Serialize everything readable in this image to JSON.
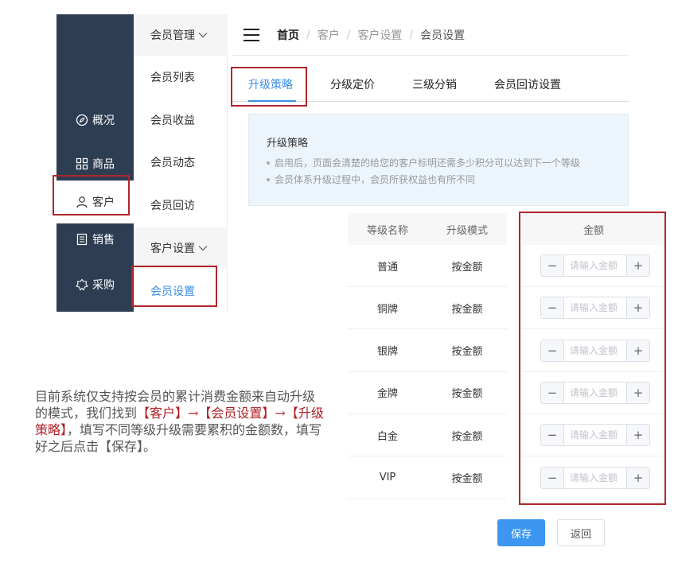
{
  "dark_sidebar": {
    "items": [
      {
        "label": "概况",
        "icon": "compass-icon"
      },
      {
        "label": "商品",
        "icon": "grid-icon"
      },
      {
        "label": "客户",
        "icon": "user-icon"
      },
      {
        "label": "销售",
        "icon": "document-icon"
      },
      {
        "label": "采购",
        "icon": "badge-icon"
      }
    ]
  },
  "sub_menu": {
    "group1": "会员管理",
    "items1": [
      "会员列表",
      "会员收益",
      "会员动态",
      "会员回访"
    ],
    "group2": "客户设置",
    "items2": [
      "会员设置"
    ]
  },
  "breadcrumb": [
    "首页",
    "客户",
    "客户设置",
    "会员设置"
  ],
  "tabs": [
    "升级策略",
    "分级定价",
    "三级分销",
    "会员回访设置"
  ],
  "info": {
    "title": "升级策略",
    "lines": [
      "启用后，页面会清楚的给您的客户标明还需多少积分可以达到下一个等级",
      "会员体系升级过程中，会员所获权益也有所不同"
    ]
  },
  "table": {
    "headers": [
      "等级名称",
      "升级模式",
      "金额"
    ],
    "rows": [
      {
        "name": "普通",
        "mode": "按金额"
      },
      {
        "name": "铜牌",
        "mode": "按金额"
      },
      {
        "name": "银牌",
        "mode": "按金额"
      },
      {
        "name": "金牌",
        "mode": "按金额"
      },
      {
        "name": "白金",
        "mode": "按金额"
      },
      {
        "name": "VIP",
        "mode": "按金额"
      }
    ],
    "amount_placeholder": "请输入金额",
    "minus": "−",
    "plus": "+"
  },
  "buttons": {
    "save": "保存",
    "back": "返回"
  },
  "note": {
    "p1": "目前系统仅支持按会员的累计消费金额来自动升级的模式，我们找到",
    "r1": "【客户】→【会员设置】→【升级策略】",
    "p2": "，填写不同等级升级需要累积的金额数，填写好之后点击【保存】。"
  },
  "colors": {
    "sidebar": "#2e3e52",
    "accent": "#3a8ee6",
    "highlight": "#b0262c",
    "save": "#3d97f0"
  }
}
